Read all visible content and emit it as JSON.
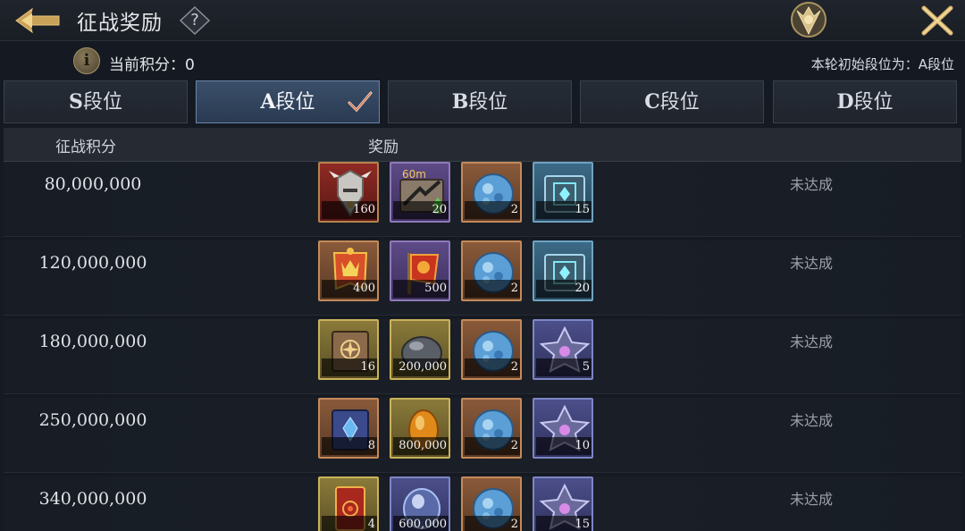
{
  "header": {
    "title": "征战奖励",
    "help_label": "?"
  },
  "subheader": {
    "score_label": "当前积分：0",
    "initial_rank": "本轮初始段位为：A段位"
  },
  "tabs": [
    {
      "letter": "S",
      "suffix": "段位",
      "active": false
    },
    {
      "letter": "A",
      "suffix": "段位",
      "active": true
    },
    {
      "letter": "B",
      "suffix": "段位",
      "active": false
    },
    {
      "letter": "C",
      "suffix": "段位",
      "active": false
    },
    {
      "letter": "D",
      "suffix": "段位",
      "active": false
    }
  ],
  "columns": {
    "points": "征战积分",
    "rewards": "奖励"
  },
  "rows": [
    {
      "points": "80,000,000",
      "status": "未达成",
      "rewards": [
        {
          "icon": "armor-helmet-icon",
          "frame": "red",
          "qty": "160"
        },
        {
          "icon": "speedup-60m-icon",
          "frame": "purple",
          "qty": "20"
        },
        {
          "icon": "blue-gem-icon",
          "frame": "orange",
          "qty": "2"
        },
        {
          "icon": "crystal-chest-icon",
          "frame": "blue",
          "qty": "15"
        }
      ]
    },
    {
      "points": "120,000,000",
      "status": "未达成",
      "rewards": [
        {
          "icon": "gold-crown-banner-icon",
          "frame": "orange",
          "qty": "400"
        },
        {
          "icon": "red-banner-icon",
          "frame": "purple",
          "qty": "500"
        },
        {
          "icon": "blue-gem-icon",
          "frame": "orange",
          "qty": "2"
        },
        {
          "icon": "crystal-chest-icon",
          "frame": "blue",
          "qty": "20"
        }
      ]
    },
    {
      "points": "180,000,000",
      "status": "未达成",
      "rewards": [
        {
          "icon": "tome-book-icon",
          "frame": "gold",
          "qty": "16"
        },
        {
          "icon": "iron-ore-icon",
          "frame": "gold",
          "qty": "200,000"
        },
        {
          "icon": "blue-gem-icon",
          "frame": "orange",
          "qty": "2"
        },
        {
          "icon": "star-relic-icon",
          "frame": "bluepurple",
          "qty": "5"
        }
      ]
    },
    {
      "points": "250,000,000",
      "status": "未达成",
      "rewards": [
        {
          "icon": "blue-tome-icon",
          "frame": "orange",
          "qty": "8"
        },
        {
          "icon": "amber-stone-icon",
          "frame": "gold",
          "qty": "800,000"
        },
        {
          "icon": "blue-gem-icon",
          "frame": "orange",
          "qty": "2"
        },
        {
          "icon": "star-relic-icon",
          "frame": "bluepurple",
          "qty": "10"
        }
      ]
    },
    {
      "points": "340,000,000",
      "status": "未达成",
      "rewards": [
        {
          "icon": "red-scroll-icon",
          "frame": "gold",
          "qty": "4"
        },
        {
          "icon": "spirit-stone-icon",
          "frame": "bluepurple",
          "qty": "600,000"
        },
        {
          "icon": "blue-gem-icon",
          "frame": "orange",
          "qty": "2"
        },
        {
          "icon": "star-relic-icon",
          "frame": "bluepurple",
          "qty": "15"
        }
      ]
    }
  ]
}
